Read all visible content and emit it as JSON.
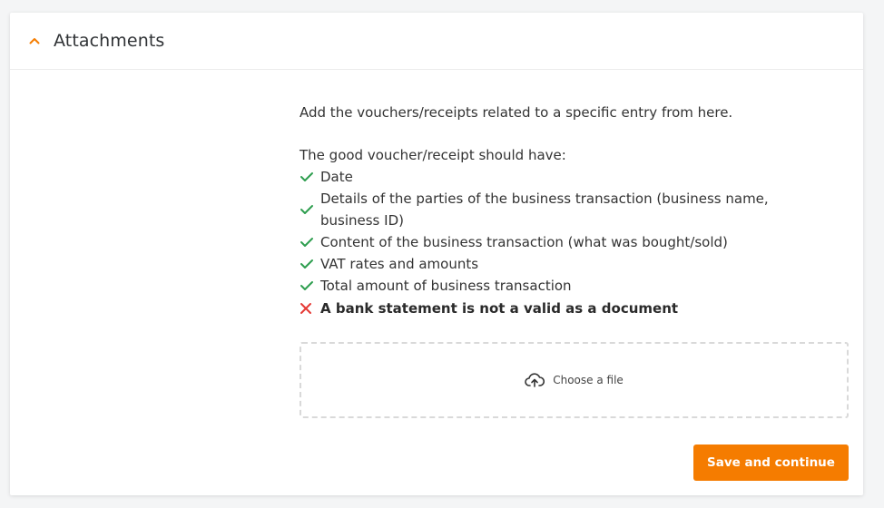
{
  "section": {
    "title": "Attachments",
    "collapse_icon": "chevron-up-icon",
    "accent_color": "#f57c00"
  },
  "content": {
    "intro": "Add the vouchers/receipts related to a specific entry from here.",
    "checklist_heading": "The good voucher/receipt should have:",
    "checklist": [
      {
        "icon": "check-icon",
        "text": "Date"
      },
      {
        "icon": "check-icon",
        "text": "Details of the parties of the business transaction (business name, business ID)"
      },
      {
        "icon": "check-icon",
        "text": "Content of the business transaction (what was bought/sold)"
      },
      {
        "icon": "check-icon",
        "text": "VAT rates and amounts"
      },
      {
        "icon": "check-icon",
        "text": "Total amount of business transaction"
      }
    ],
    "warning": {
      "icon": "cross-icon",
      "text": "A bank statement is not a valid as a document"
    }
  },
  "upload": {
    "icon": "cloud-upload-icon",
    "label": "Choose a file"
  },
  "actions": {
    "save_label": "Save and continue"
  },
  "colors": {
    "check": "#2e9e4f",
    "cross": "#e53935",
    "button_bg": "#f57c00"
  }
}
